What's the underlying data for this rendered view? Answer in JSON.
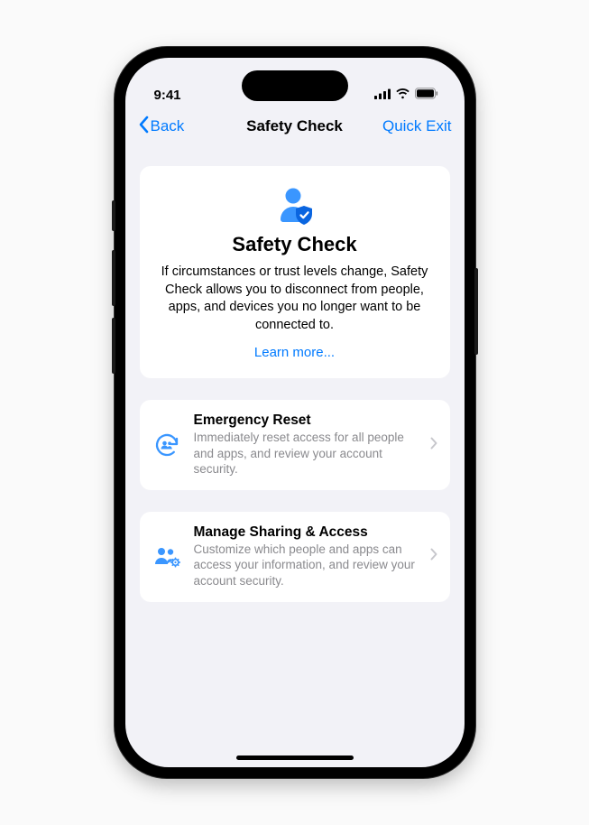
{
  "status": {
    "time": "9:41"
  },
  "nav": {
    "back": "Back",
    "title": "Safety Check",
    "right": "Quick Exit"
  },
  "hero": {
    "title": "Safety Check",
    "desc": "If circumstances or trust levels change, Safety Check allows you to disconnect from people, apps, and devices you no longer want to be connected to.",
    "learn_more": "Learn more..."
  },
  "rows": {
    "emergency": {
      "title": "Emergency Reset",
      "desc": "Immediately reset access for all people and apps, and review your account security."
    },
    "manage": {
      "title": "Manage Sharing & Access",
      "desc": "Customize which people and apps can access your information, and review your account security."
    }
  }
}
